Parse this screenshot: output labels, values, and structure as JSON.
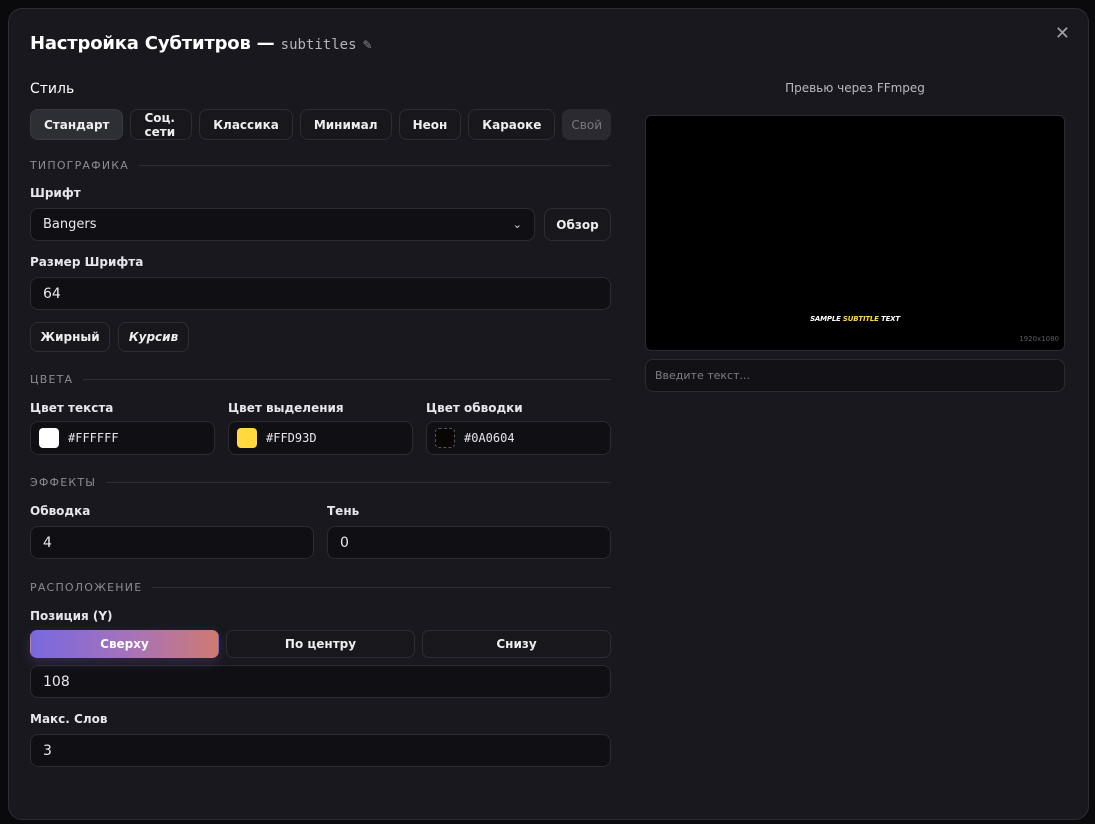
{
  "dialog": {
    "title": "Настройка Субтитров",
    "dash": "—",
    "filename": "subtitles",
    "close": "✕"
  },
  "style": {
    "label": "Стиль",
    "presets": [
      "Стандарт",
      "Соц. сети",
      "Классика",
      "Минимал",
      "Неон",
      "Караоке"
    ],
    "selected": "Стандарт",
    "custom": "Свой"
  },
  "typography": {
    "section": "ТИПОГРАФИКА",
    "font_label": "Шрифт",
    "font_value": "Bangers",
    "browse": "Обзор",
    "size_label": "Размер Шрифта",
    "size_value": "64",
    "bold": "Жирный",
    "italic": "Курсив"
  },
  "colors": {
    "section": "ЦВЕТА",
    "text_label": "Цвет текста",
    "text_value": "#FFFFFF",
    "highlight_label": "Цвет выделения",
    "highlight_value": "#FFD93D",
    "outline_label": "Цвет обводки",
    "outline_value": "#0A0604"
  },
  "effects": {
    "section": "ЭФФЕКТЫ",
    "outline_label": "Обводка",
    "outline_value": "4",
    "shadow_label": "Тень",
    "shadow_value": "0"
  },
  "layout": {
    "section": "РАСПОЛОЖЕНИЕ",
    "position_label": "Позиция (Y)",
    "top": "Сверху",
    "center": "По центру",
    "bottom": "Снизу",
    "selected": "Сверху",
    "y_value": "108",
    "max_words_label": "Макс. Слов",
    "max_words_value": "3"
  },
  "preview": {
    "label": "Превью через FFmpeg",
    "sample_pre": "SAMPLE ",
    "sample_hl": "SUBTITLE",
    "sample_post": " TEXT",
    "resolution": "1920x1080",
    "input_placeholder": "Введите текст..."
  },
  "accent_gradient": [
    "#7868e0",
    "#cf7a72"
  ]
}
